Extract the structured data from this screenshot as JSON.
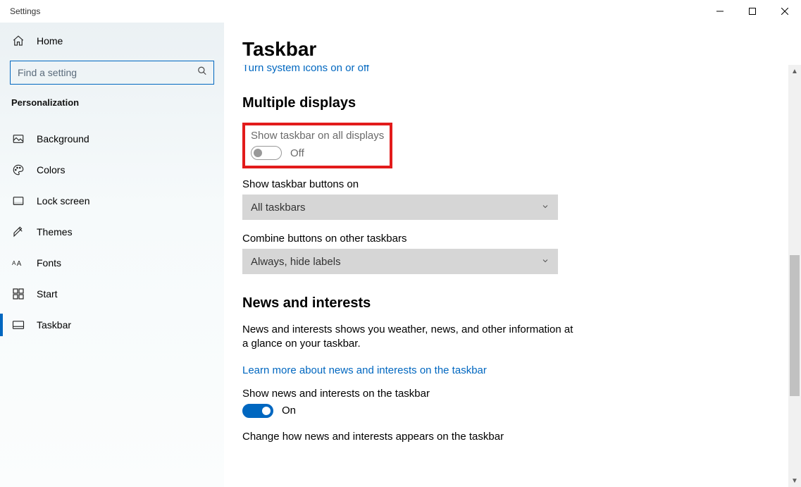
{
  "titlebar": {
    "title": "Settings"
  },
  "sidebar": {
    "home_label": "Home",
    "search_placeholder": "Find a setting",
    "category": "Personalization",
    "items": [
      {
        "label": "Background"
      },
      {
        "label": "Colors"
      },
      {
        "label": "Lock screen"
      },
      {
        "label": "Themes"
      },
      {
        "label": "Fonts"
      },
      {
        "label": "Start"
      },
      {
        "label": "Taskbar"
      }
    ]
  },
  "main": {
    "page_title": "Taskbar",
    "cropped_link": "Turn system icons on or off",
    "sections": {
      "multiple_displays": {
        "title": "Multiple displays",
        "show_all": {
          "label": "Show taskbar on all displays",
          "state_text": "Off"
        },
        "show_buttons": {
          "label": "Show taskbar buttons on",
          "value": "All taskbars"
        },
        "combine": {
          "label": "Combine buttons on other taskbars",
          "value": "Always, hide labels"
        }
      },
      "news": {
        "title": "News and interests",
        "desc": "News and interests shows you weather, news, and other information at a glance on your taskbar.",
        "learn_link": "Learn more about news and interests on the taskbar",
        "show_news": {
          "label": "Show news and interests on the taskbar",
          "state_text": "On"
        },
        "change_label": "Change how news and interests appears on the taskbar"
      }
    }
  }
}
